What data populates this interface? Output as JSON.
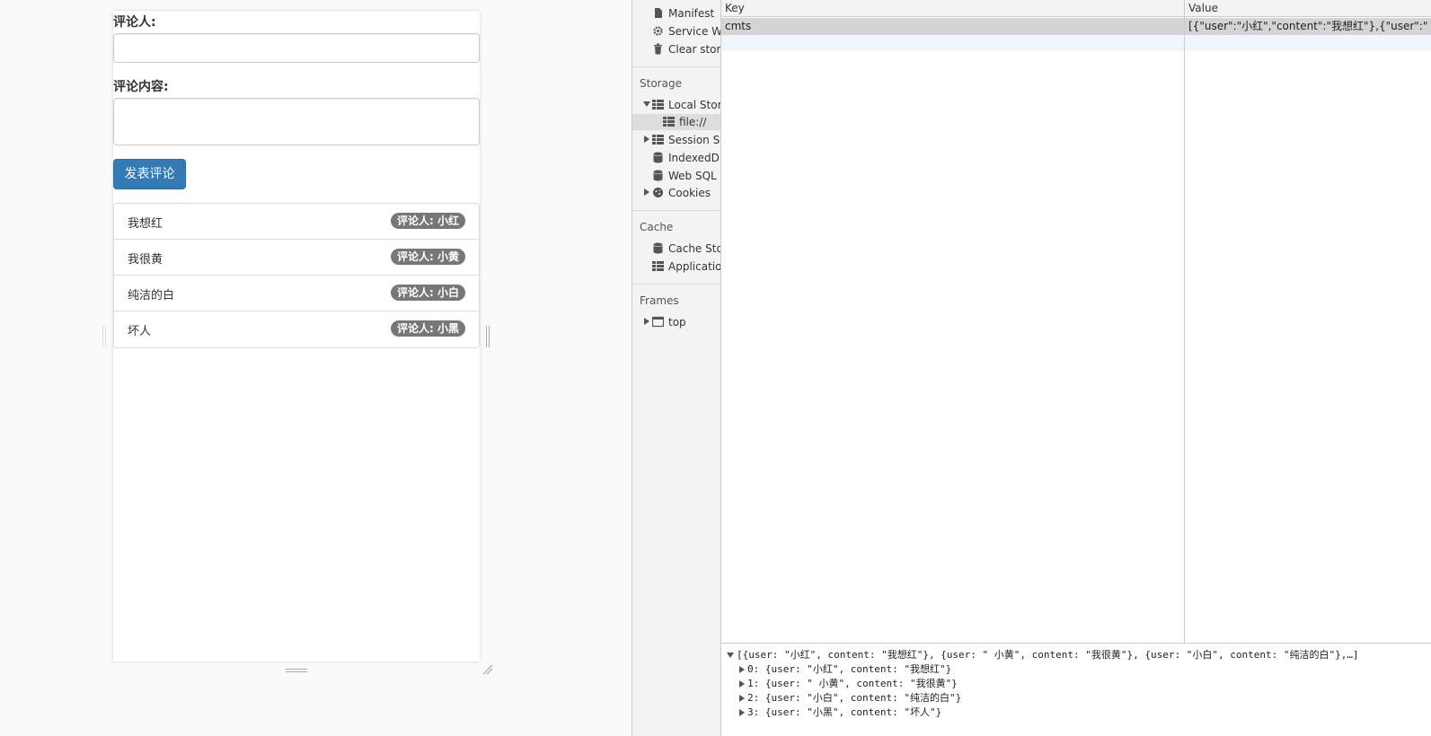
{
  "form": {
    "user_label": "评论人:",
    "user_value": "",
    "content_label": "评论内容:",
    "content_value": "",
    "submit_label": "发表评论"
  },
  "comments": [
    {
      "content": "我想红",
      "badge": "评论人: 小红"
    },
    {
      "content": "我很黄",
      "badge": "评论人: 小黄"
    },
    {
      "content": "纯洁的白",
      "badge": "评论人: 小白"
    },
    {
      "content": "坏人",
      "badge": "评论人: 小黑"
    }
  ],
  "sidebar": {
    "manifest": "Manifest",
    "service_workers": "Service Workers",
    "clear_storage": "Clear storage",
    "storage_header": "Storage",
    "local_storage": "Local Storage",
    "local_storage_file": "file://",
    "session_storage": "Session Storage",
    "indexeddb": "IndexedDB",
    "web_sql": "Web SQL",
    "cookies": "Cookies",
    "cache_header": "Cache",
    "cache_storage": "Cache Storage",
    "application_cache": "Application Cache",
    "frames_header": "Frames",
    "top": "top"
  },
  "table": {
    "key_header": "Key",
    "value_header": "Value",
    "rows": [
      {
        "key": "cmts",
        "value": "[{\"user\":\"小红\",\"content\":\"我想红\"},{\"user\":\" 小黄\",\"content\":\"我很黄\"},{\"user\":\"小白\",\"content\":\"纯洁的白\"},{\"user\":\"小黑\",\"content\":\"坏人\"}]"
      }
    ]
  },
  "preview": {
    "summary": "[{user: \"小红\", content: \"我想红\"}, {user: \" 小黄\", content: \"我很黄\"}, {user: \"小白\", content: \"纯洁的白\"},…]",
    "items": [
      "0: {user: \"小红\", content: \"我想红\"}",
      "1: {user: \" 小黄\", content: \"我很黄\"}",
      "2: {user: \"小白\", content: \"纯洁的白\"}",
      "3: {user: \"小黑\", content: \"坏人\"}"
    ]
  }
}
